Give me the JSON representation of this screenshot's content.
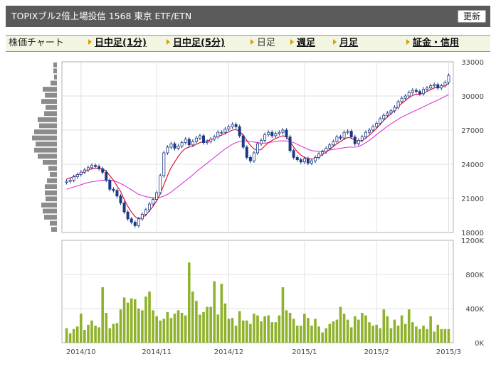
{
  "header": {
    "title": "TOPIXブル2倍上場投信  1568  東京 ETF/ETN",
    "refresh_label": "更新"
  },
  "tabs": {
    "label": "株価チャート",
    "items": [
      {
        "label": "日中足(1分)",
        "link": true
      },
      {
        "label": "日中足(5分)",
        "link": true
      },
      {
        "label": "日足",
        "link": false
      },
      {
        "label": "週足",
        "link": true
      },
      {
        "label": "月足",
        "link": true
      },
      {
        "label": "証金・信用",
        "link": true
      }
    ]
  },
  "colors": {
    "up_candle": "#ffffff",
    "down_candle": "#1b3a86",
    "ma_short": "#e0002b",
    "ma_long": "#d83ad8",
    "volume_bar": "#8fb22c",
    "profile_bar": "#8c8c8c"
  },
  "chart_data": {
    "type": "candlestick",
    "price_axis": {
      "ticks": [
        "33000",
        "30000",
        "27000",
        "24000",
        "21000",
        "18000"
      ],
      "ylim": [
        18000,
        33000
      ]
    },
    "volume_axis": {
      "ticks": [
        "1200K",
        "800K",
        "400K",
        "0K"
      ],
      "ylim": [
        0,
        1200000
      ]
    },
    "x_labels": [
      "2014/10",
      "2014/11",
      "2014/12",
      "2015/1",
      "2015/2",
      "2015/3"
    ],
    "x_label_index": [
      4,
      25,
      45,
      66,
      86,
      106
    ],
    "close": [
      22500,
      22600,
      22900,
      23100,
      23300,
      23500,
      23700,
      23900,
      23800,
      23600,
      23300,
      22600,
      21800,
      21700,
      21200,
      20600,
      19800,
      19200,
      18900,
      18600,
      19200,
      19600,
      20000,
      20500,
      20900,
      21500,
      23000,
      25000,
      25500,
      25800,
      25400,
      25600,
      25900,
      26200,
      25700,
      26000,
      26300,
      26500,
      25900,
      26000,
      26200,
      26400,
      26800,
      26800,
      27100,
      27300,
      27500,
      27300,
      26500,
      25500,
      24600,
      24300,
      25000,
      25800,
      26100,
      26600,
      26800,
      26500,
      26700,
      26800,
      27000,
      26400,
      25200,
      24600,
      24400,
      24200,
      24500,
      24100,
      24300,
      24600,
      24900,
      25100,
      25400,
      25700,
      26000,
      26400,
      26300,
      26800,
      26900,
      26400,
      25800,
      26100,
      26400,
      26800,
      27000,
      27300,
      27600,
      28000,
      28300,
      28500,
      28700,
      29000,
      29500,
      29800,
      30000,
      30300,
      30500,
      30400,
      30200,
      30600,
      30700,
      30900,
      31000,
      30700,
      30900,
      31200,
      31800
    ],
    "volume": [
      170000,
      110000,
      160000,
      190000,
      340000,
      150000,
      210000,
      260000,
      200000,
      180000,
      650000,
      350000,
      170000,
      220000,
      230000,
      390000,
      530000,
      470000,
      520000,
      510000,
      400000,
      380000,
      540000,
      600000,
      380000,
      310000,
      260000,
      280000,
      360000,
      290000,
      340000,
      380000,
      350000,
      320000,
      940000,
      600000,
      490000,
      330000,
      360000,
      420000,
      420000,
      720000,
      330000,
      690000,
      460000,
      280000,
      290000,
      200000,
      370000,
      260000,
      260000,
      220000,
      340000,
      320000,
      250000,
      310000,
      320000,
      240000,
      240000,
      320000,
      650000,
      380000,
      350000,
      280000,
      200000,
      200000,
      340000,
      290000,
      200000,
      280000,
      190000,
      120000,
      170000,
      220000,
      250000,
      270000,
      420000,
      340000,
      270000,
      180000,
      310000,
      270000,
      350000,
      320000,
      240000,
      200000,
      210000,
      170000,
      390000,
      310000,
      170000,
      270000,
      200000,
      320000,
      220000,
      390000,
      240000,
      190000,
      160000,
      200000,
      160000,
      310000,
      130000,
      210000,
      160000,
      160000,
      160000
    ],
    "ma_short": [
      22700,
      22800,
      22900,
      23050,
      23200,
      23350,
      23500,
      23600,
      23650,
      23650,
      23600,
      23400,
      23000,
      22600,
      22100,
      21600,
      20900,
      20300,
      19800,
      19400,
      19200,
      19300,
      19550,
      19900,
      20300,
      20800,
      21400,
      22200,
      23000,
      23700,
      24200,
      24700,
      25100,
      25400,
      25500,
      25600,
      25750,
      25900,
      26000,
      26050,
      26150,
      26300,
      26450,
      26550,
      26700,
      26850,
      27000,
      27050,
      26900,
      26550,
      26100,
      25650,
      25350,
      25200,
      25300,
      25600,
      25900,
      26100,
      26250,
      26400,
      26500,
      26400,
      26000,
      25500,
      25100,
      24800,
      24600,
      24500,
      24450,
      24500,
      24650,
      24850,
      25050,
      25300,
      25550,
      25800,
      26000,
      26200,
      26350,
      26300,
      26100,
      26000,
      26100,
      26300,
      26550,
      26850,
      27150,
      27500,
      27850,
      28150,
      28450,
      28750,
      29050,
      29350,
      29600,
      29850,
      30050,
      30150,
      30150,
      30250,
      30400,
      30550,
      30700,
      30750,
      30800,
      30900,
      31100
    ],
    "ma_long": [
      21800,
      21900,
      22000,
      22100,
      22200,
      22300,
      22400,
      22450,
      22500,
      22550,
      22600,
      22600,
      22600,
      22550,
      22450,
      22300,
      22150,
      21950,
      21750,
      21550,
      21350,
      21250,
      21150,
      21100,
      21050,
      21050,
      21100,
      21200,
      21350,
      21550,
      21800,
      22050,
      22300,
      22550,
      22800,
      23050,
      23350,
      23600,
      23850,
      24100,
      24350,
      24600,
      24850,
      25100,
      25350,
      25550,
      25750,
      25900,
      26000,
      26050,
      26050,
      26000,
      25950,
      25900,
      25850,
      25850,
      25900,
      25950,
      26000,
      26050,
      26050,
      26050,
      26000,
      25900,
      25750,
      25600,
      25450,
      25300,
      25200,
      25150,
      25150,
      25150,
      25200,
      25250,
      25300,
      25350,
      25400,
      25450,
      25500,
      25500,
      25500,
      25550,
      25700,
      25900,
      26100,
      26350,
      26600,
      26850,
      27100,
      27350,
      27550,
      27750,
      27950,
      28150,
      28300,
      28450,
      28600,
      28750,
      28900,
      29050,
      29200,
      29350,
      29500,
      29650,
      29800,
      29950,
      30150
    ],
    "volume_profile": [
      5,
      5,
      4,
      9,
      20,
      17,
      22,
      16,
      18,
      27,
      25,
      32,
      35,
      30,
      32,
      27,
      20,
      12,
      10,
      14,
      17,
      17,
      16,
      22,
      20,
      18,
      10,
      8
    ]
  }
}
